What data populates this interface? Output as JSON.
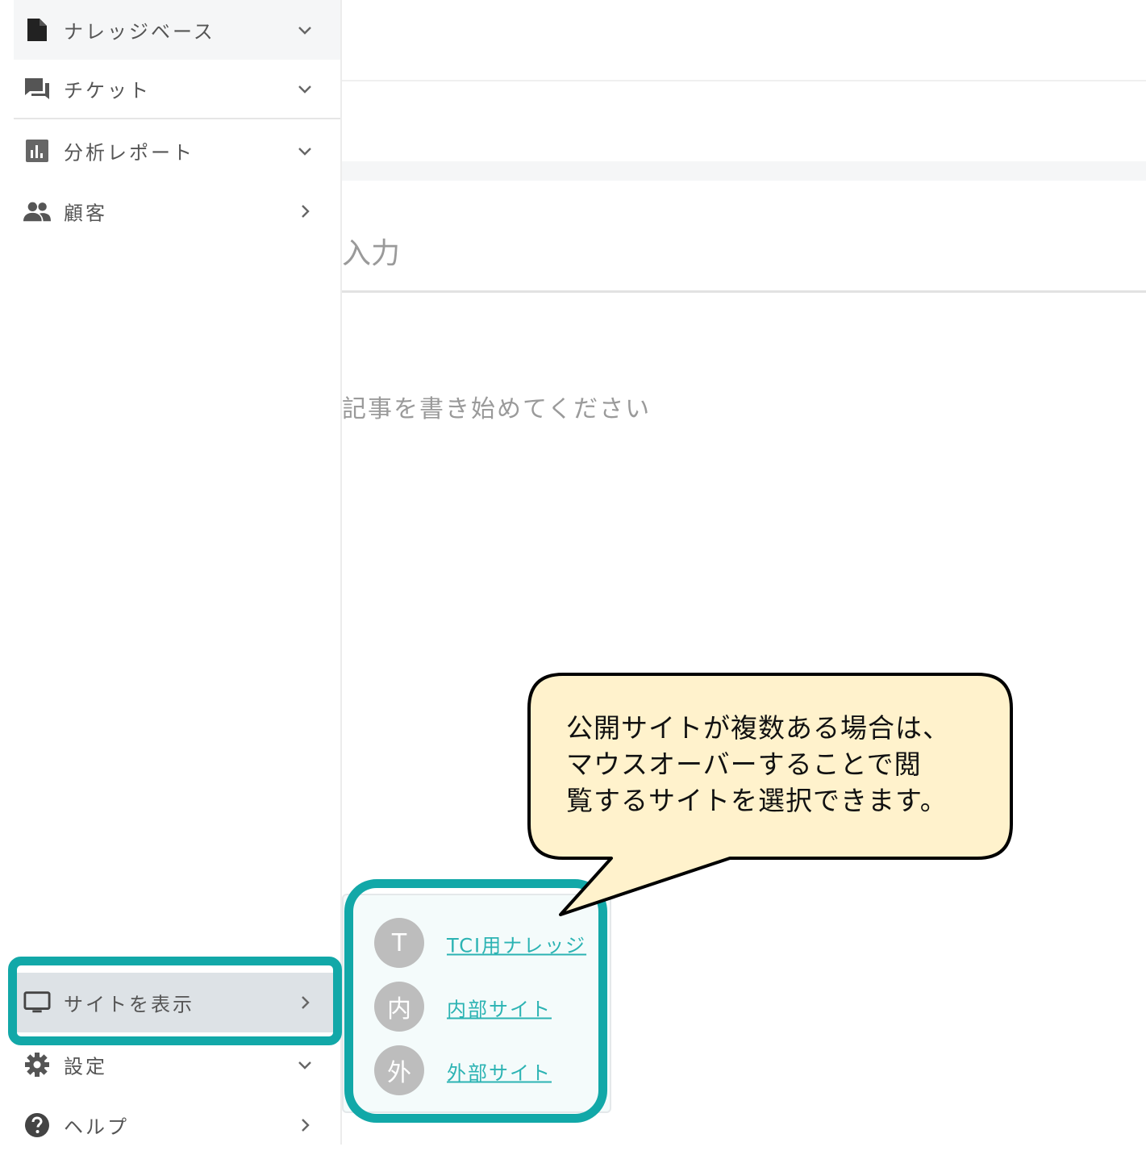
{
  "sidebar": {
    "items": [
      {
        "label": "ナレッジベース",
        "icon": "document-icon",
        "chevron": "chevron-down-icon"
      },
      {
        "label": "チケット",
        "icon": "chat-icon",
        "chevron": "chevron-down-icon"
      },
      {
        "label": "分析レポート",
        "icon": "bar-chart-icon",
        "chevron": "chevron-down-icon"
      },
      {
        "label": "顧客",
        "icon": "people-icon",
        "chevron": "chevron-right-icon"
      },
      {
        "label": "サイトを表示",
        "icon": "monitor-icon",
        "chevron": "chevron-right-icon"
      },
      {
        "label": "設定",
        "icon": "gear-icon",
        "chevron": "chevron-down-icon"
      },
      {
        "label": "ヘルプ",
        "icon": "help-icon",
        "chevron": "chevron-right-icon"
      }
    ]
  },
  "editor": {
    "title_placeholder": "入力",
    "body_placeholder": "記事を書き始めてください"
  },
  "site_popup": {
    "sites": [
      {
        "avatar": "T",
        "name": "TCI用ナレッジ"
      },
      {
        "avatar": "内",
        "name": "内部サイト"
      },
      {
        "avatar": "外",
        "name": "外部サイト"
      }
    ]
  },
  "callout": {
    "lines": [
      "公開サイトが複数ある場合は、",
      "マウスオーバーすることで閲",
      "覧するサイトを選択できます。"
    ]
  },
  "colors": {
    "highlight": "#12a8a8",
    "callout_fill": "#fff2cc",
    "link": "#2bb3b3"
  }
}
